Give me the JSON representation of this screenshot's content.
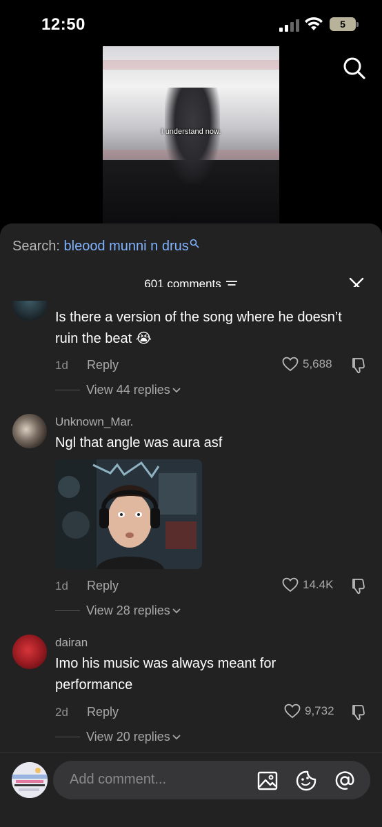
{
  "status_bar": {
    "time": "12:50",
    "battery": "5"
  },
  "video": {
    "caption": "I understand now."
  },
  "sheet": {
    "search_label": "Search:",
    "search_term": "bleood munni n drus",
    "comment_count": "601 comments"
  },
  "comments": [
    {
      "username": "",
      "text": "Is there a version of the song where he doesn’t ruin the beat 😭",
      "age": "1d",
      "reply_label": "Reply",
      "likes": "5,688",
      "view_replies": "View 44 replies"
    },
    {
      "username": "Unknown_Mar.",
      "text": "Ngl that angle was aura asf",
      "age": "1d",
      "reply_label": "Reply",
      "likes": "14.4K",
      "view_replies": "View 28 replies"
    },
    {
      "username": "dairan",
      "text": "Imo his music was always meant for performance",
      "age": "2d",
      "reply_label": "Reply",
      "likes": "9,732",
      "view_replies": "View 20 replies"
    }
  ],
  "composer": {
    "placeholder": "Add comment..."
  },
  "icons": {
    "search": "search-icon",
    "sort": "sort-icon",
    "close": "close-icon",
    "heart": "heart-icon",
    "dislike": "dislike-icon",
    "chevron": "chevron-down-icon",
    "image": "image-icon",
    "emoji": "sticker-icon",
    "mention": "at-icon"
  },
  "colors": {
    "accent": "#80b3ff",
    "sheet": "#222223",
    "muted": "#a8a8a8"
  }
}
